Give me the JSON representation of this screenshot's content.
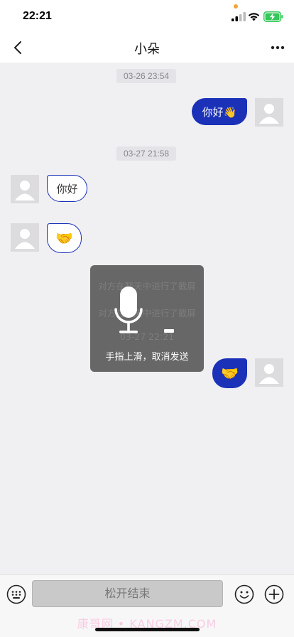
{
  "status": {
    "time": "22:21",
    "dot_color": "#f2a33a",
    "battery_color": "#35c759"
  },
  "nav": {
    "title": "小朵",
    "back_icon": "chevron-left-icon",
    "more_icon": "more-dots-icon"
  },
  "messages": {
    "time1": "03-26 23:54",
    "out1": "你好👋",
    "time2": "03-27 21:58",
    "in1": "你好",
    "in2": "🤝",
    "out2": "🤝"
  },
  "background_notices": {
    "screenshot_notice_1": "对方在聊天中进行了截屏",
    "screenshot_notice_2": "对方在聊天中进行了截屏",
    "time3": "03-27 22:21"
  },
  "voice_overlay": {
    "hint": "手指上滑，取消发送",
    "icon": "microphone-icon"
  },
  "input_bar": {
    "hold_label": "松开结束",
    "keyboard_icon": "keyboard-icon",
    "emoji_icon": "emoji-icon",
    "plus_icon": "plus-icon"
  },
  "watermark": "康哥网 • KANGZM.COM",
  "colors": {
    "accent": "#1a31b8",
    "chat_bg": "#f0f0f2"
  }
}
